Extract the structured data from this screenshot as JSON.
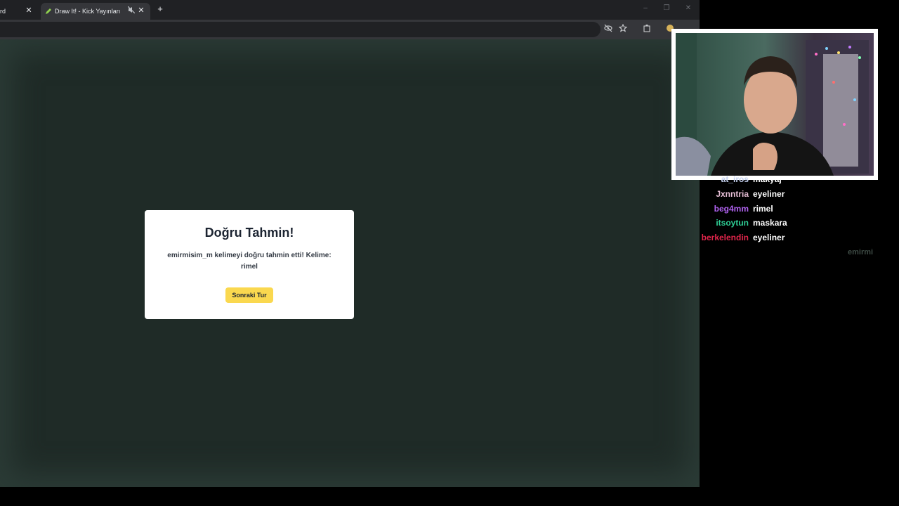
{
  "browser": {
    "tabs": [
      {
        "title": "rd",
        "close_glyph": "✕"
      },
      {
        "title": "Draw It! - Kick Yayınları İçin",
        "close_glyph": "✕",
        "mute_glyph": "🔇"
      }
    ],
    "new_tab_glyph": "+",
    "window_controls": {
      "minimize": "–",
      "restore": "❐",
      "close": "✕"
    },
    "toolbar_icons": [
      "eye-off-icon",
      "star-icon",
      "extensions-icon",
      "profile-icon",
      "menu-icon"
    ]
  },
  "dialog": {
    "title": "Doğru Tahmin!",
    "message": "emirmisim_m kelimeyi doğru tahmin etti! Kelime: rimel",
    "button_label": "Sonraki Tur"
  },
  "chat": {
    "messages": [
      {
        "user": "at_iros",
        "text": "makyaj",
        "color": "#c6d2f0"
      },
      {
        "user": "Jxnntria",
        "text": "eyeliner",
        "color": "#e7bfd6"
      },
      {
        "user": "beg4mm",
        "text": "rimel",
        "color": "#b062f0"
      },
      {
        "user": "itsoytun",
        "text": "maskara",
        "color": "#2fcf96"
      },
      {
        "user": "berkelendin",
        "text": "eyeliner",
        "color": "#e0254b"
      }
    ],
    "footer_name": "emirmi"
  },
  "colors": {
    "page_bg": "#1f2b27",
    "button_yellow": "#fad84f",
    "dialog_bg": "#ffffff"
  }
}
